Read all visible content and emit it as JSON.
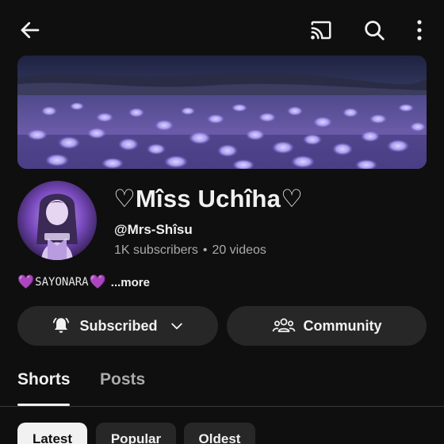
{
  "appbar": {
    "back_icon": "arrow-left-icon",
    "cast_icon": "cast-icon",
    "search_icon": "search-icon",
    "more_icon": "more-vert-icon"
  },
  "channel": {
    "name": "♡Mîss Uchîha♡",
    "handle": "@Mrs-Shîsu",
    "subscribers": "1K subscribers",
    "separator": "•",
    "videos": "20 videos",
    "description": {
      "heart_left": "💜",
      "text": "SAYONARA",
      "heart_right": "💜",
      "more": "...more"
    }
  },
  "actions": {
    "subscribed_label": "Subscribed",
    "community_label": "Community"
  },
  "tabs": [
    {
      "label": "Shorts",
      "active": true
    },
    {
      "label": "Posts",
      "active": false
    }
  ],
  "chips": [
    {
      "label": "Latest",
      "selected": true
    },
    {
      "label": "Popular",
      "selected": false
    },
    {
      "label": "Oldest",
      "selected": false
    }
  ],
  "colors": {
    "background": "#0f0f0f",
    "surface": "#272727",
    "text": "#f1f1f1",
    "secondary_text": "#aaaaaa",
    "accent_purple": "#a64dff"
  }
}
